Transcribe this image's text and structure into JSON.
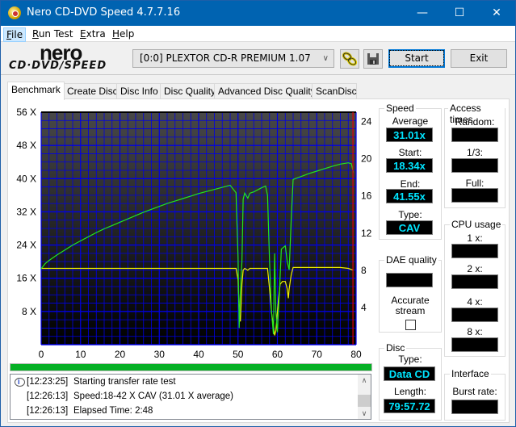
{
  "window": {
    "title": "Nero CD-DVD Speed 4.7.7.16",
    "minimize_glyph": "—",
    "maximize_glyph": "☐",
    "close_glyph": "✕"
  },
  "menu": [
    {
      "label": "File",
      "hotkey": "F",
      "rest": "ile"
    },
    {
      "label": "Run Test",
      "hotkey": "R",
      "rest": "un Test"
    },
    {
      "label": "Extra",
      "hotkey": "E",
      "rest": "xtra"
    },
    {
      "label": "Help",
      "hotkey": "H",
      "rest": "elp"
    }
  ],
  "logo": {
    "top": "nero",
    "bottom": "CD·DVD∕SPEED"
  },
  "toolbar": {
    "drive": "[0:0]  PLEXTOR CD-R   PREMIUM 1.07",
    "chevron": "∨",
    "start_label": "Start",
    "exit_label": "Exit"
  },
  "tabs": [
    "Benchmark",
    "Create Disc",
    "Disc Info",
    "Disc Quality",
    "Advanced Disc Quality",
    "ScanDisc"
  ],
  "active_tab": "Benchmark",
  "colors": {
    "speed_line": "#22e61e",
    "secondary_line": "#f0f000",
    "grid": "#0000e6",
    "end_marker": "#e60000",
    "progress": "#06b025",
    "readout_text": "#00e5ff"
  },
  "chart_data": {
    "type": "line",
    "title": "",
    "x_ticks": [
      "0",
      "10",
      "20",
      "30",
      "40",
      "50",
      "60",
      "70",
      "80"
    ],
    "xlim": [
      0,
      80
    ],
    "y_left_ticks": [
      "8 X",
      "16 X",
      "24 X",
      "32 X",
      "40 X",
      "48 X",
      "56 X"
    ],
    "y_left_lim": [
      0,
      56
    ],
    "y_right_ticks": [
      "4",
      "8",
      "12",
      "16",
      "20",
      "24"
    ],
    "y_right_lim": [
      0,
      25
    ],
    "grid": true,
    "end_marker_x": 79.2,
    "series": [
      {
        "name": "Transfer speed",
        "axis": "left",
        "x": [
          0,
          1,
          2,
          4,
          6,
          8,
          10,
          12,
          14,
          16,
          18,
          20,
          22,
          24,
          26,
          28,
          30,
          32,
          34,
          36,
          38,
          40,
          42,
          44,
          46,
          48,
          49.5,
          50,
          50.3,
          50.6,
          51,
          51.3,
          51.7,
          52.5,
          53,
          54,
          55,
          56,
          57,
          57.5,
          58,
          58.5,
          59,
          59.3,
          59.6,
          60,
          60.5,
          61,
          62,
          62.5,
          63,
          63.5,
          64,
          66,
          68,
          70,
          72,
          74,
          76,
          78,
          78.8,
          79.3
        ],
        "y": [
          18.3,
          19.5,
          20.3,
          21.6,
          22.8,
          24.0,
          25.0,
          26.0,
          27.0,
          27.9,
          28.7,
          29.5,
          30.3,
          31.1,
          31.9,
          32.6,
          33.3,
          34.0,
          34.6,
          35.2,
          35.8,
          36.4,
          36.9,
          37.4,
          37.9,
          38.4,
          36.6,
          21.0,
          4.0,
          13.0,
          20.0,
          35.0,
          36.5,
          35.3,
          36.5,
          36.8,
          37.3,
          37.8,
          38.2,
          36.0,
          20.0,
          8.0,
          2.5,
          22.0,
          8.0,
          3.0,
          12.0,
          23.0,
          23.8,
          20.0,
          18.0,
          30.0,
          39.8,
          40.5,
          41.2,
          41.8,
          42.4,
          43.0,
          43.5,
          43.8,
          43.6,
          41.5
        ]
      },
      {
        "name": "Secondary trace",
        "axis": "right",
        "x": [
          0,
          5,
          10,
          15,
          20,
          25,
          30,
          35,
          40,
          45,
          49.5,
          50,
          50.3,
          50.6,
          51,
          51.3,
          51.7,
          52.5,
          53,
          54,
          55,
          56,
          57.5,
          58,
          58.5,
          59,
          59.3,
          59.6,
          60,
          60.3,
          60.7,
          61.3,
          62,
          62.5,
          62.8,
          63,
          63.5,
          64,
          66,
          68,
          70,
          72,
          74,
          76,
          78,
          79.3
        ],
        "y": [
          8.2,
          8.2,
          8.2,
          8.2,
          8.2,
          8.2,
          8.2,
          8.2,
          8.2,
          8.2,
          8.2,
          7.0,
          3.5,
          2.5,
          6.5,
          8.0,
          8.2,
          8.0,
          8.2,
          8.2,
          8.2,
          8.2,
          8.2,
          6.0,
          3.5,
          2.0,
          1.0,
          1.5,
          3.5,
          5.0,
          6.5,
          6.8,
          6.8,
          6.0,
          5.0,
          6.0,
          7.5,
          8.3,
          8.3,
          8.3,
          8.3,
          8.3,
          8.3,
          8.3,
          8.2,
          8.0
        ]
      }
    ]
  },
  "speed": {
    "title": "Speed",
    "average_label": "Average",
    "average": "31.01x",
    "start_label": "Start:",
    "start": "18.34x",
    "end_label": "End:",
    "end": "41.55x",
    "type_label": "Type:",
    "type": "CAV"
  },
  "access_times": {
    "title": "Access times",
    "random_label": "Random:",
    "random": "",
    "third_label": "1/3:",
    "third": "",
    "full_label": "Full:",
    "full": ""
  },
  "cpu_usage": {
    "title": "CPU usage",
    "labels": [
      "1 x:",
      "2 x:",
      "4 x:",
      "8 x:"
    ],
    "values": [
      "",
      "",
      "",
      ""
    ]
  },
  "dae_quality": {
    "title": "DAE quality",
    "value": "",
    "accurate_stream_label_1": "Accurate",
    "accurate_stream_label_2": "stream",
    "accurate_stream_checked": false
  },
  "disc": {
    "title": "Disc",
    "type_label": "Type:",
    "type": "Data CD",
    "length_label": "Length:",
    "length": "79:57.72"
  },
  "interface": {
    "title": "Interface",
    "burst_label": "Burst rate:",
    "burst": ""
  },
  "progress": {
    "value_percent": 100
  },
  "log": [
    {
      "time": "[12:23:25]",
      "message": "Starting transfer rate test",
      "icon": "info-icon"
    },
    {
      "time": "[12:26:13]",
      "message": "Speed:18-42 X CAV (31.01 X average)"
    },
    {
      "time": "[12:26:13]",
      "message": "Elapsed Time:  2:48"
    }
  ]
}
